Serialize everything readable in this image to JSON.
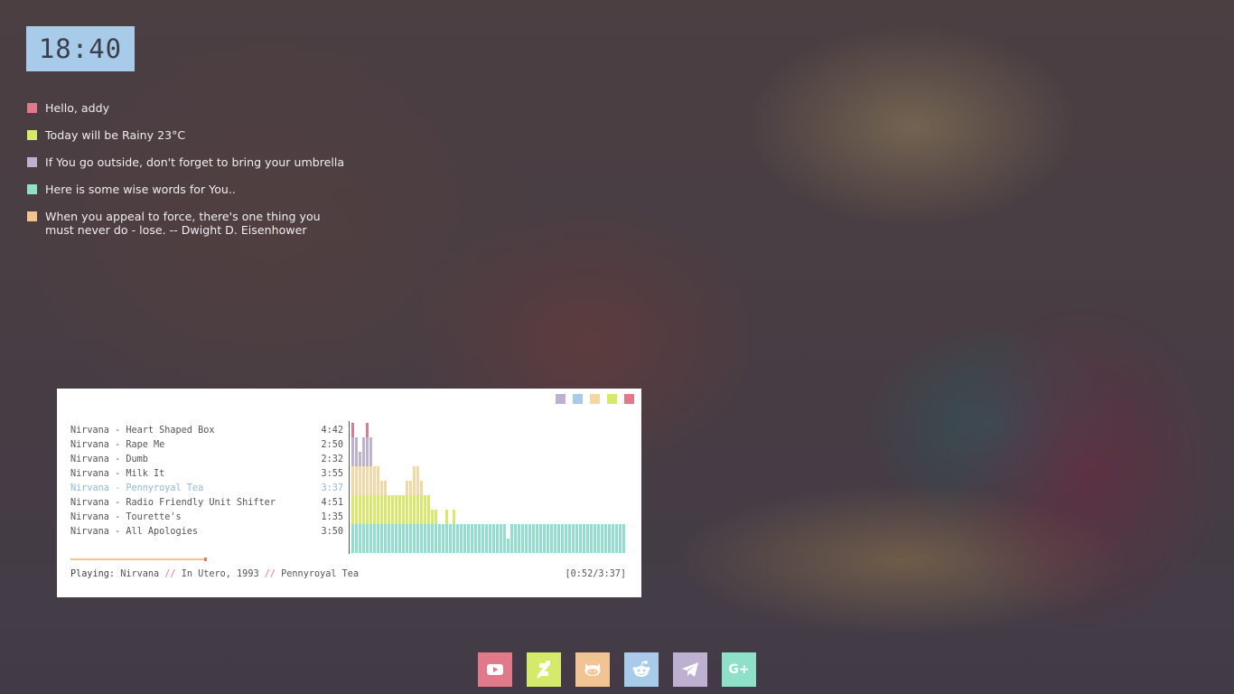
{
  "clock": {
    "time": "18:40"
  },
  "messages": [
    {
      "text": "Hello, addy",
      "color": "#e07a8a"
    },
    {
      "text": "Today will be Rainy 23°C",
      "color": "#d5ea6a"
    },
    {
      "text": "If You go outside, don't forget to bring your umbrella",
      "color": "#bdb0d0"
    },
    {
      "text": "Here is some wise words for You..",
      "color": "#8fe0c8"
    },
    {
      "text": "When you appeal to force, there's one thing you must never do - lose.  -- Dwight D. Eisenhower",
      "color": "#f2c493"
    }
  ],
  "player": {
    "window_dots": [
      "#bdb0d0",
      "#a8cbea",
      "#f7d6a6",
      "#d5ea6a",
      "#e07a8a"
    ],
    "playlist": [
      {
        "title": "Nirvana - Heart Shaped Box",
        "duration": "4:42"
      },
      {
        "title": "Nirvana - Rape Me",
        "duration": "2:50"
      },
      {
        "title": "Nirvana - Dumb",
        "duration": "2:32"
      },
      {
        "title": "Nirvana - Milk It",
        "duration": "3:55"
      },
      {
        "title": "Nirvana - Pennyroyal Tea",
        "duration": "3:37",
        "active": true
      },
      {
        "title": "Nirvana - Radio Friendly Unit Shifter",
        "duration": "4:51"
      },
      {
        "title": "Nirvana - Tourette's",
        "duration": "1:35"
      },
      {
        "title": "Nirvana - All Apologies",
        "duration": "3:50"
      }
    ],
    "visualizer": {
      "colors": [
        "#8fe0c8",
        "#d5ea6a",
        "#f7d6a6",
        "#bdb0d0",
        "#e07a8a"
      ],
      "levels": [
        9,
        8,
        7,
        8,
        9,
        8,
        6,
        6,
        5,
        5,
        4,
        4,
        4,
        4,
        4,
        5,
        5,
        6,
        6,
        5,
        4,
        4,
        3,
        3,
        2,
        2,
        3,
        2,
        3,
        2,
        2,
        2,
        2,
        2,
        2,
        2,
        2,
        2,
        2,
        2,
        2,
        2,
        2,
        1,
        2,
        2,
        2,
        2,
        2,
        2,
        2,
        2,
        2,
        2,
        2,
        2,
        2,
        2,
        2,
        2,
        2,
        2,
        2,
        2,
        2,
        2,
        2,
        2,
        2,
        2,
        2,
        2,
        2,
        2,
        2,
        2
      ]
    },
    "progress": 0.24,
    "status": {
      "label": "Playing:",
      "artist": "Nirvana",
      "sep1": "//",
      "album": "In Utero, 1993",
      "sep2": "//",
      "track": "Pennyroyal Tea",
      "time": "[0:52/3:37]"
    }
  },
  "dock": [
    {
      "name": "youtube",
      "icon": "youtube-icon",
      "color": "#e07a8a"
    },
    {
      "name": "deviantart",
      "icon": "deviantart-icon",
      "color": "#d5ea6a"
    },
    {
      "name": "github",
      "icon": "github-icon",
      "color": "#f2c493"
    },
    {
      "name": "reddit",
      "icon": "reddit-icon",
      "color": "#a8cbea"
    },
    {
      "name": "telegram",
      "icon": "telegram-icon",
      "color": "#bdb0d0"
    },
    {
      "name": "google-plus",
      "icon": "google-plus-icon",
      "color": "#8fe0c8",
      "label": "G+"
    }
  ]
}
